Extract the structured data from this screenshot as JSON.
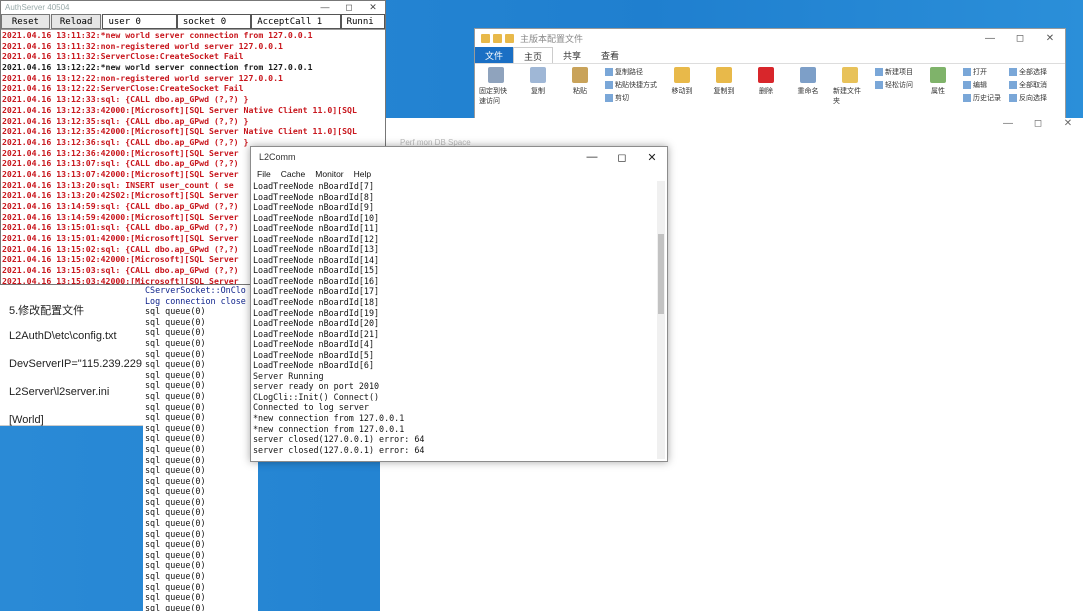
{
  "explorer": {
    "title": "主版本配置文件",
    "tabs": [
      "文件",
      "主页",
      "共享",
      "查看"
    ],
    "ribbon_buttons": [
      "固定到快速访问",
      "复制",
      "粘贴",
      "移动到",
      "复制到",
      "删除",
      "重命名",
      "新建文件夹",
      "属性"
    ],
    "ribbon_small": [
      "复制路径",
      "粘贴快捷方式",
      "剪切",
      "新建项目",
      "轻松访问",
      "打开",
      "编辑",
      "历史记录",
      "全部选择",
      "全部取消",
      "反向选择"
    ]
  },
  "perf": {
    "faint_text": "Perf mon  DB Space"
  },
  "auth": {
    "title": "AuthServer 40504",
    "buttons": {
      "reset": "Reset",
      "reload": "Reload"
    },
    "stats": [
      "user 0",
      "socket 0",
      "AcceptCall 1",
      "Runni"
    ],
    "lines": [
      {
        "t": "2021.04.16 13:11:32:*new world server connection from 127.0.0.1",
        "c": "red"
      },
      {
        "t": "2021.04.16 13:11:32:non-registered world server 127.0.0.1",
        "c": "red"
      },
      {
        "t": "2021.04.16 13:11:32:ServerClose:CreateSocket Fail",
        "c": "red"
      },
      {
        "t": "2021.04.16 13:12:22:*new world server connection from 127.0.0.1",
        "c": "dark"
      },
      {
        "t": "2021.04.16 13:12:22:non-registered world server 127.0.0.1",
        "c": "red"
      },
      {
        "t": "2021.04.16 13:12:22:ServerClose:CreateSocket Fail",
        "c": "red"
      },
      {
        "t": "2021.04.16 13:12:33:sql: {CALL dbo.ap_GPwd (?,?) }",
        "c": "red"
      },
      {
        "t": "2021.04.16 13:12:33:42000:[Microsoft][SQL Server Native Client 11.0][SQL",
        "c": "red"
      },
      {
        "t": "2021.04.16 13:12:35:sql: {CALL dbo.ap_GPwd (?,?) }",
        "c": "red"
      },
      {
        "t": "2021.04.16 13:12:35:42000:[Microsoft][SQL Server Native Client 11.0][SQL",
        "c": "red"
      },
      {
        "t": "2021.04.16 13:12:36:sql: {CALL dbo.ap_GPwd (?,?) }",
        "c": "red"
      },
      {
        "t": "2021.04.16 13:12:36:42000:[Microsoft][SQL Server",
        "c": "red"
      },
      {
        "t": "2021.04.16 13:13:07:sql: {CALL dbo.ap_GPwd (?,?)",
        "c": "red"
      },
      {
        "t": "2021.04.16 13:13:07:42000:[Microsoft][SQL Server",
        "c": "red"
      },
      {
        "t": "2021.04.16 13:13:20:sql: INSERT user_count ( se",
        "c": "red"
      },
      {
        "t": "2021.04.16 13:13:20:42S02:[Microsoft][SQL Server",
        "c": "red"
      },
      {
        "t": "2021.04.16 13:14:59:sql: {CALL dbo.ap_GPwd (?,?)",
        "c": "red"
      },
      {
        "t": "2021.04.16 13:14:59:42000:[Microsoft][SQL Server",
        "c": "red"
      },
      {
        "t": "2021.04.16 13:15:01:sql: {CALL dbo.ap_GPwd (?,?)",
        "c": "red"
      },
      {
        "t": "2021.04.16 13:15:01:42000:[Microsoft][SQL Server",
        "c": "red"
      },
      {
        "t": "2021.04.16 13:15:02:sql: {CALL dbo.ap_GPwd (?,?)",
        "c": "red"
      },
      {
        "t": "2021.04.16 13:15:02:42000:[Microsoft][SQL Server",
        "c": "red"
      },
      {
        "t": "2021.04.16 13:15:03:sql: {CALL dbo.ap_GPwd (?,?)",
        "c": "red"
      },
      {
        "t": "2021.04.16 13:15:03:42000:[Microsoft][SQL Server",
        "c": "red"
      }
    ]
  },
  "notepad": {
    "lines": [
      "5.修改配置文件",
      "L2AuthD\\etc\\config.txt",
      "DevServerIP=\"115.239.229.",
      "L2Server\\l2server.ini",
      "[World]"
    ]
  },
  "console2": {
    "head": [
      "CServerSocket::OnClo",
      "Log connection close"
    ],
    "queue_line": "sql queue(0)",
    "queue_count": 31
  },
  "l2comm": {
    "title": "L2Comm",
    "menu": [
      "File",
      "Cache",
      "Monitor",
      "Help"
    ],
    "lines": [
      "LoadTreeNode nBoardId[7]",
      "LoadTreeNode nBoardId[8]",
      "LoadTreeNode nBoardId[9]",
      "LoadTreeNode nBoardId[10]",
      "LoadTreeNode nBoardId[11]",
      "LoadTreeNode nBoardId[12]",
      "LoadTreeNode nBoardId[13]",
      "LoadTreeNode nBoardId[14]",
      "LoadTreeNode nBoardId[15]",
      "LoadTreeNode nBoardId[16]",
      "LoadTreeNode nBoardId[17]",
      "LoadTreeNode nBoardId[18]",
      "LoadTreeNode nBoardId[19]",
      "LoadTreeNode nBoardId[20]",
      "LoadTreeNode nBoardId[21]",
      "LoadTreeNode nBoardId[4]",
      "LoadTreeNode nBoardId[5]",
      "LoadTreeNode nBoardId[6]",
      "Server Running",
      "server ready on port 2010",
      "CLogCli::Init()  Connect()",
      "Connected to log server",
      "*new connection from 127.0.0.1",
      "*new connection from 127.0.0.1",
      "server closed(127.0.0.1) error: 64",
      "server closed(127.0.0.1) error: 64"
    ],
    "scroll_position": 0.27
  }
}
